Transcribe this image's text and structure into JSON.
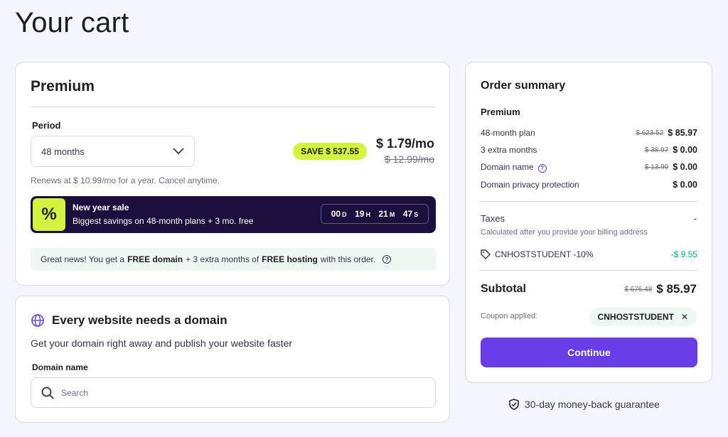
{
  "page": {
    "title": "Your cart"
  },
  "plan": {
    "name": "Premium",
    "period_label": "Period",
    "period_value": "48 months",
    "save_badge": "SAVE $ 537.55",
    "price": "$ 1.79/mo",
    "old_price": "$ 12.99/mo",
    "renews": "Renews at $ 10.99/mo for a year. Cancel anytime.",
    "sale": {
      "icon": "%",
      "title": "New year sale",
      "subtitle": "Biggest savings on 48-month plans + 3 mo. free",
      "timer": [
        {
          "value": "00",
          "unit": "D"
        },
        {
          "value": "19",
          "unit": "H"
        },
        {
          "value": "21",
          "unit": "M"
        },
        {
          "value": "47",
          "unit": "S"
        }
      ]
    },
    "free_note": {
      "prefix": "Great news! You get a",
      "bold1": "FREE domain",
      "middle": "+ 3 extra months of",
      "bold2": "FREE hosting",
      "suffix": "with this order."
    }
  },
  "domain": {
    "title": "Every website needs a domain",
    "subtitle": "Get your domain right away and publish your website faster",
    "label": "Domain name",
    "placeholder": "Search"
  },
  "summary": {
    "title": "Order summary",
    "plan": "Premium",
    "rows": [
      {
        "label": "48-month plan",
        "old": "$ 623.52",
        "new": "$ 85.97"
      },
      {
        "label": "3 extra months",
        "old": "$ 38.97",
        "new": "$ 0.00"
      },
      {
        "label": "Domain name",
        "old": "$ 13.99",
        "new": "$ 0.00"
      },
      {
        "label": "Domain privacy protection",
        "old": "",
        "new": "$ 0.00"
      }
    ],
    "taxes_label": "Taxes",
    "taxes_value": "-",
    "taxes_note": "Calculated after you provide your billing address",
    "coupon_code": "CNHOSTSTUDENT -10%",
    "coupon_discount": "-$ 9.55",
    "subtotal_label": "Subtotal",
    "subtotal_old": "$ 676.48",
    "subtotal_new": "$ 85.97",
    "coupon_applied_label": "Coupon applied:",
    "coupon_chip": "CNHOSTSTUDENT",
    "continue_label": "Continue"
  },
  "guarantee": "30-day money-back guarantee",
  "colors": {
    "accent": "#673de6",
    "lime": "#d3f33e",
    "dark_banner": "#1a0f3d",
    "green": "#00b090"
  }
}
